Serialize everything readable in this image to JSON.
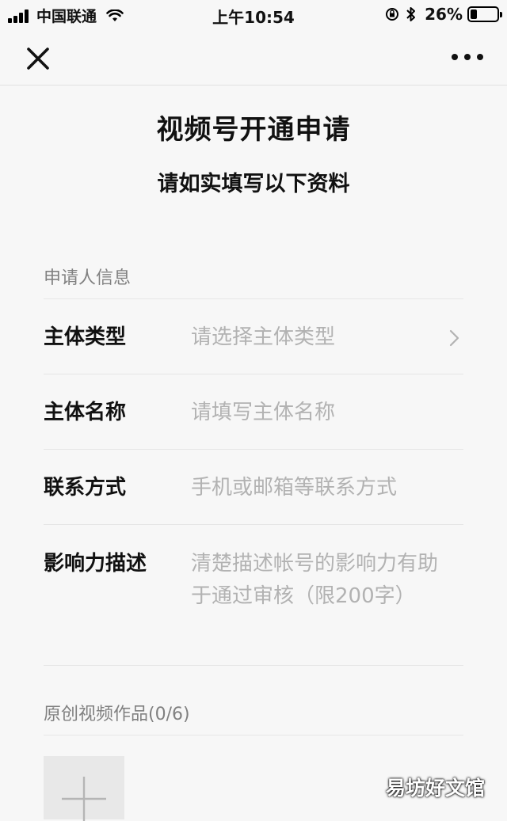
{
  "status_bar": {
    "carrier": "中国联通",
    "time": "上午10:54",
    "battery": "26%",
    "battery_level": 0.26
  },
  "nav": {
    "close_icon": "close-icon",
    "more_icon": "more-icon"
  },
  "page": {
    "title": "视频号开通申请",
    "subtitle": "请如实填写以下资料"
  },
  "applicant_section": {
    "title": "申请人信息",
    "fields": [
      {
        "label": "主体类型",
        "placeholder": "请选择主体类型",
        "type": "select"
      },
      {
        "label": "主体名称",
        "placeholder": "请填写主体名称",
        "type": "text"
      },
      {
        "label": "联系方式",
        "placeholder": "手机或邮箱等联系方式",
        "type": "text"
      },
      {
        "label": "影响力描述",
        "placeholder": "清楚描述帐号的影响力有助于通过审核（限200字）",
        "type": "textarea"
      }
    ]
  },
  "works_section": {
    "title": "原创视频作品(0/6)",
    "add_icon": "plus-icon"
  },
  "watermark": "易坊好文馆"
}
